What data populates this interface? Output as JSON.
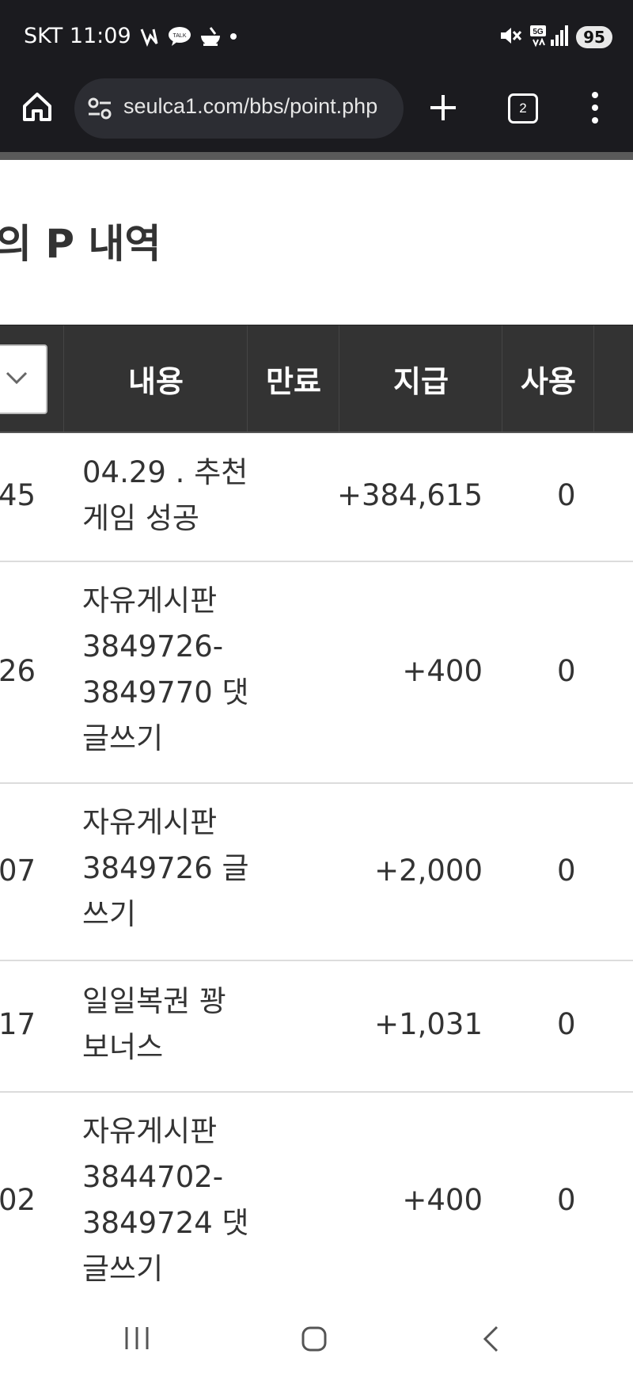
{
  "status_bar": {
    "carrier_time": "SKT 11:09",
    "battery": "95"
  },
  "browser": {
    "url": "seulca1.com/bbs/point.php",
    "tab_count": "2"
  },
  "page": {
    "title": "의 P 내역"
  },
  "table": {
    "headers": {
      "content": "내용",
      "expire": "만료",
      "give": "지급",
      "use": "사용"
    },
    "rows": [
      {
        "id": "45",
        "content": "04.29 . 추천게임 성공",
        "give": "+384,615",
        "use": "0"
      },
      {
        "id": "26",
        "content": "자유게시판 3849726-3849770 댓글쓰기",
        "give": "+400",
        "use": "0"
      },
      {
        "id": "07",
        "content": "자유게시판 3849726 글쓰기",
        "give": "+2,000",
        "use": "0"
      },
      {
        "id": "17",
        "content": "일일복권 꽝 보너스",
        "give": "+1,031",
        "use": "0"
      },
      {
        "id": "02",
        "content": "자유게시판 3844702-3849724 댓글쓰기",
        "give": "+400",
        "use": "0"
      }
    ]
  }
}
